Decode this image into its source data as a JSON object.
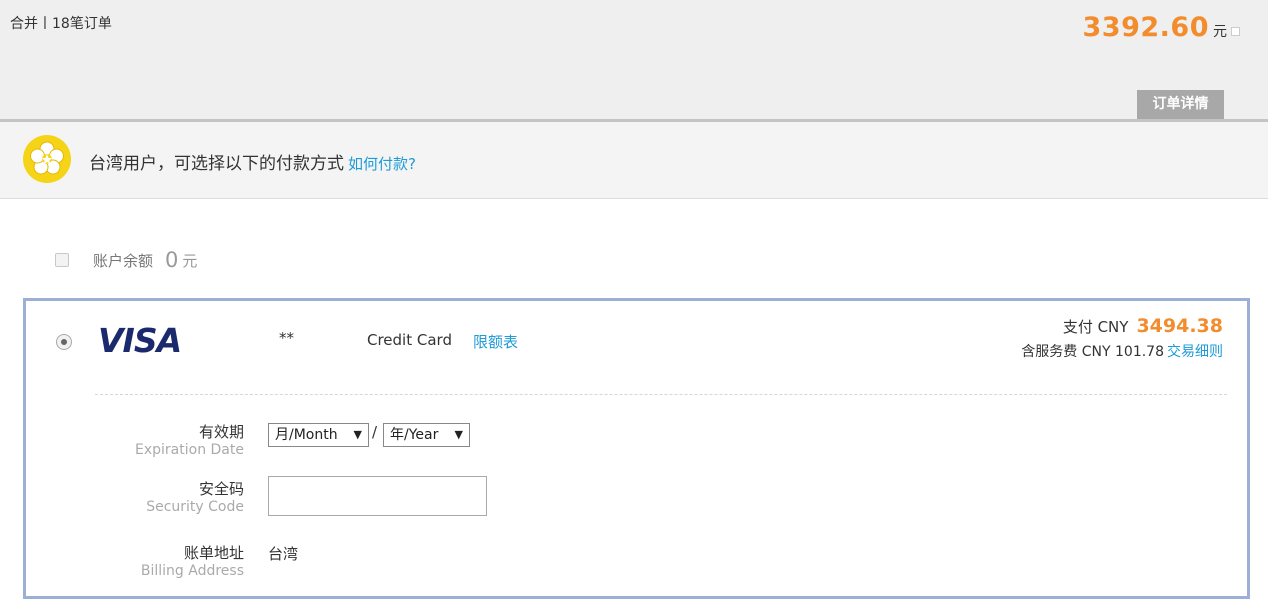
{
  "header": {
    "order_count": "合并丨18笔订单",
    "total_amount": "3392.60",
    "total_unit": "元",
    "details_tab": "订单详情"
  },
  "notice": {
    "text": "台湾用户，可选择以下的付款方式",
    "link": "如何付款?"
  },
  "balance": {
    "label": "账户余额",
    "value": "0",
    "unit": "元",
    "checked": false
  },
  "card": {
    "logo": "VISA",
    "mask": "**",
    "type": "Credit Card",
    "limit_link": "限额表",
    "pay_label": "支付 CNY",
    "pay_amount": "3494.38",
    "fee_text": "含服务费 CNY 101.78",
    "fee_link": "交易细则",
    "selected": true
  },
  "form": {
    "expiry": {
      "label_cn": "有效期",
      "label_en": "Expiration Date",
      "month": "月/Month",
      "year": "年/Year",
      "separator": "/"
    },
    "security": {
      "label_cn": "安全码",
      "label_en": "Security Code",
      "value": ""
    },
    "billing": {
      "label_cn": "账单地址",
      "label_en": "Billing Address",
      "value": "台湾"
    }
  },
  "colors": {
    "accent_orange": "#f28c2c",
    "link_blue": "#1e9bd7",
    "panel_border": "#9bb0d4",
    "visa_navy": "#1a2a6c"
  },
  "icons": {
    "notice_badge": "plum-blossom-icon",
    "dropdown": "triangle-down-icon"
  }
}
